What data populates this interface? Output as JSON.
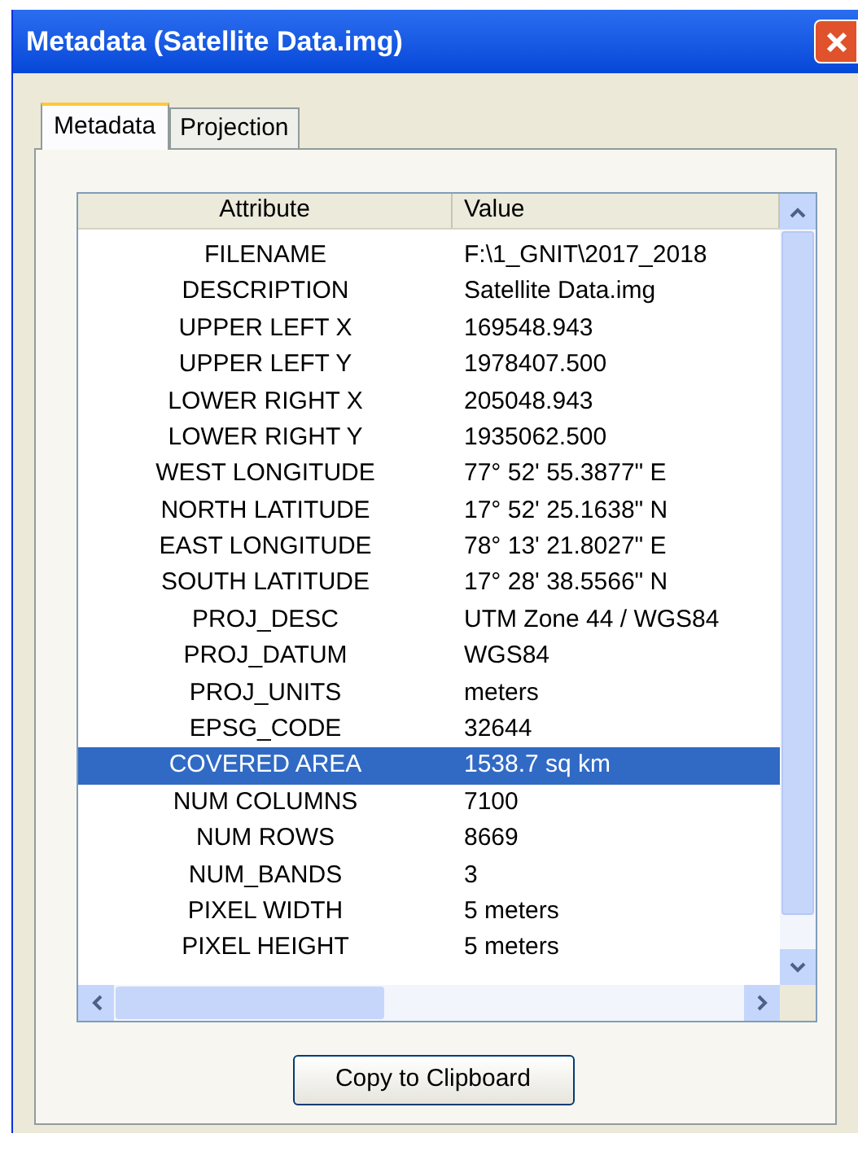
{
  "window": {
    "title": "Metadata (Satellite Data.img)"
  },
  "tabs": [
    {
      "label": "Metadata",
      "selected": true
    },
    {
      "label": "Projection",
      "selected": false
    }
  ],
  "table": {
    "columns": [
      "Attribute",
      "Value"
    ],
    "rows": [
      {
        "attribute": "FILENAME",
        "value": "F:\\1_GNIT\\2017_2018",
        "selected": false
      },
      {
        "attribute": "DESCRIPTION",
        "value": "Satellite Data.img",
        "selected": false
      },
      {
        "attribute": "UPPER LEFT X",
        "value": "169548.943",
        "selected": false
      },
      {
        "attribute": "UPPER LEFT Y",
        "value": "1978407.500",
        "selected": false
      },
      {
        "attribute": "LOWER RIGHT X",
        "value": "205048.943",
        "selected": false
      },
      {
        "attribute": "LOWER RIGHT Y",
        "value": "1935062.500",
        "selected": false
      },
      {
        "attribute": "WEST LONGITUDE",
        "value": "77° 52' 55.3877\" E",
        "selected": false
      },
      {
        "attribute": "NORTH LATITUDE",
        "value": "17° 52' 25.1638\" N",
        "selected": false
      },
      {
        "attribute": "EAST LONGITUDE",
        "value": "78° 13' 21.8027\" E",
        "selected": false
      },
      {
        "attribute": "SOUTH LATITUDE",
        "value": "17° 28' 38.5566\" N",
        "selected": false
      },
      {
        "attribute": "PROJ_DESC",
        "value": "UTM Zone 44 / WGS84",
        "selected": false
      },
      {
        "attribute": "PROJ_DATUM",
        "value": "WGS84",
        "selected": false
      },
      {
        "attribute": "PROJ_UNITS",
        "value": "meters",
        "selected": false
      },
      {
        "attribute": "EPSG_CODE",
        "value": "32644",
        "selected": false
      },
      {
        "attribute": "COVERED AREA",
        "value": "1538.7 sq km",
        "selected": true
      },
      {
        "attribute": "NUM COLUMNS",
        "value": "7100",
        "selected": false
      },
      {
        "attribute": "NUM ROWS",
        "value": "8669",
        "selected": false
      },
      {
        "attribute": "NUM_BANDS",
        "value": "3",
        "selected": false
      },
      {
        "attribute": "PIXEL WIDTH",
        "value": "5 meters",
        "selected": false
      },
      {
        "attribute": "PIXEL HEIGHT",
        "value": "5 meters",
        "selected": false
      }
    ]
  },
  "buttons": [
    "Copy to Clipboard"
  ]
}
